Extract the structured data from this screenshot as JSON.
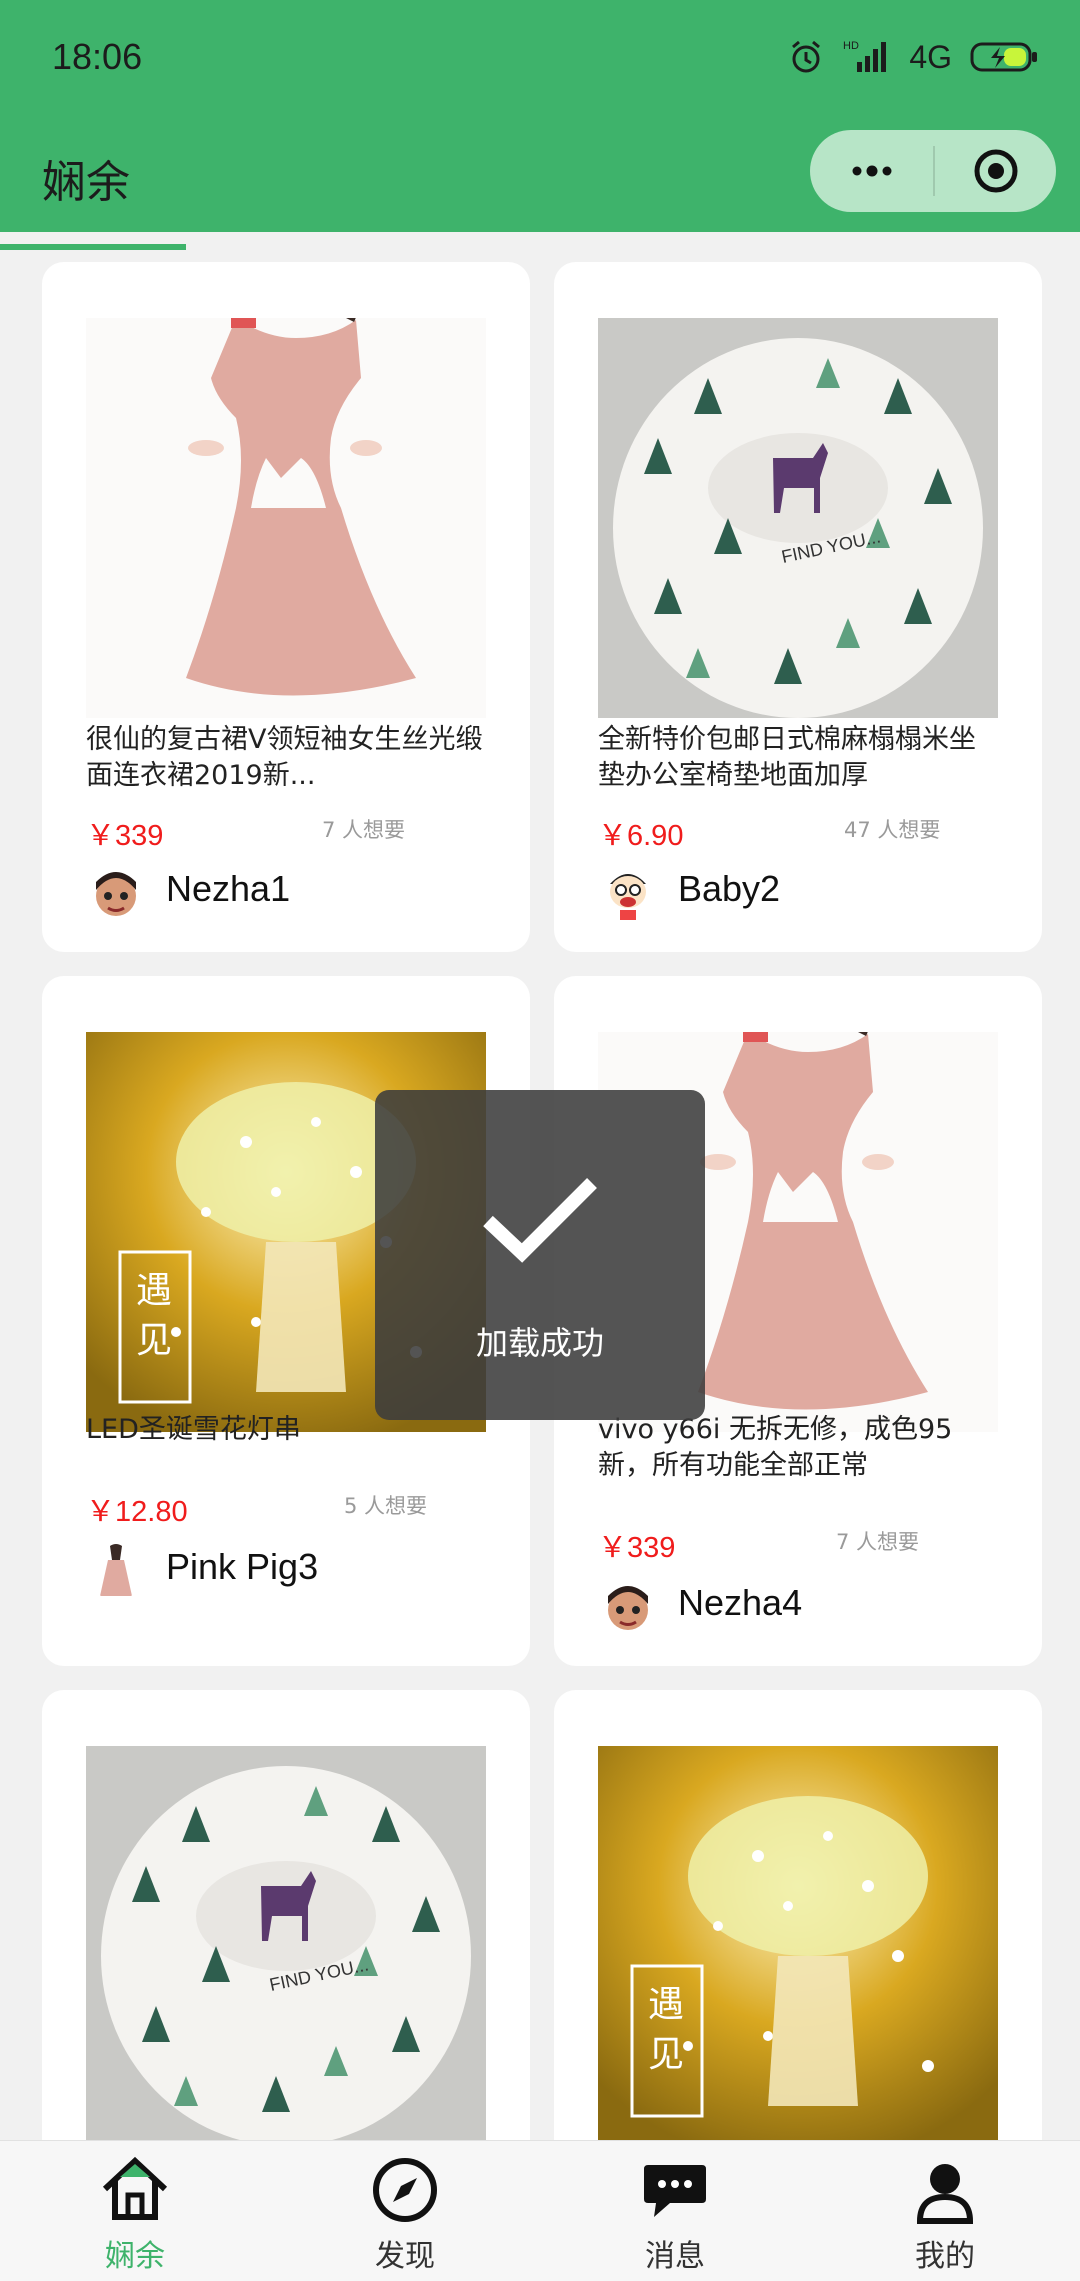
{
  "status_bar": {
    "time": "18:06",
    "network": "4G"
  },
  "navbar": {
    "title": "娴余"
  },
  "products": [
    {
      "title": "很仙的复古裙V领短袖女生丝光缎面连衣裙2019新...",
      "price": "￥339",
      "wants": "7 人想要",
      "user": "Nezha1",
      "image": "pink-dress",
      "avatar": "nezha-avatar"
    },
    {
      "title": "全新特价包邮日式棉麻榻榻米坐垫办公室椅垫地面加厚",
      "price": "￥6.90",
      "wants": "47 人想要",
      "user": "Baby2",
      "image": "tree-cushion",
      "avatar": "baby-avatar"
    },
    {
      "title": "LED圣诞雪花灯串",
      "price": "￥12.80",
      "wants": "5 人想要",
      "user": "Pink Pig3",
      "image": "snowflake-lights",
      "avatar": "dress-avatar"
    },
    {
      "title": "vivo y66i 无拆无修，成色95新，所有功能全部正常",
      "price": "￥339",
      "wants": "7 人想要",
      "user": "Nezha4",
      "image": "pink-dress",
      "avatar": "nezha-avatar"
    },
    {
      "image": "tree-cushion"
    },
    {
      "image": "snowflake-lights"
    }
  ],
  "toast": {
    "message": "加载成功"
  },
  "tabs": [
    {
      "label": "娴余",
      "icon": "home-icon",
      "active": true
    },
    {
      "label": "发现",
      "icon": "compass-icon",
      "active": false
    },
    {
      "label": "消息",
      "icon": "message-icon",
      "active": false
    },
    {
      "label": "我的",
      "icon": "profile-icon",
      "active": false
    }
  ],
  "colors": {
    "accent": "#3eb36b",
    "price": "#f01c1c",
    "toast_bg": "#3c3c3c"
  }
}
